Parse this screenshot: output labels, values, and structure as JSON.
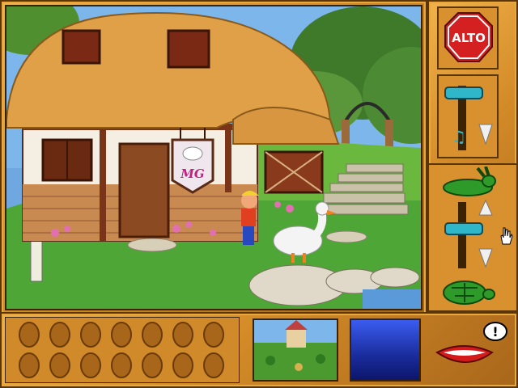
{
  "controls": {
    "stop_label": "ALTO"
  },
  "icons": {
    "stop": "stop-sign-icon",
    "music": "music-note-icon",
    "volume_down": "arrow-down-icon",
    "speed_up": "rabbit-icon",
    "speed_down": "turtle-icon",
    "talk": "mouth-speech-icon",
    "cursor": "hand-pointer-icon"
  },
  "sign": {
    "initials": "MG"
  },
  "colors": {
    "frame": "#d38b28",
    "stop_red": "#d42020",
    "slider_teal": "#2fb6c8",
    "blue_box": "#1a2c9c"
  },
  "inventory": {
    "slot_count": 14
  }
}
